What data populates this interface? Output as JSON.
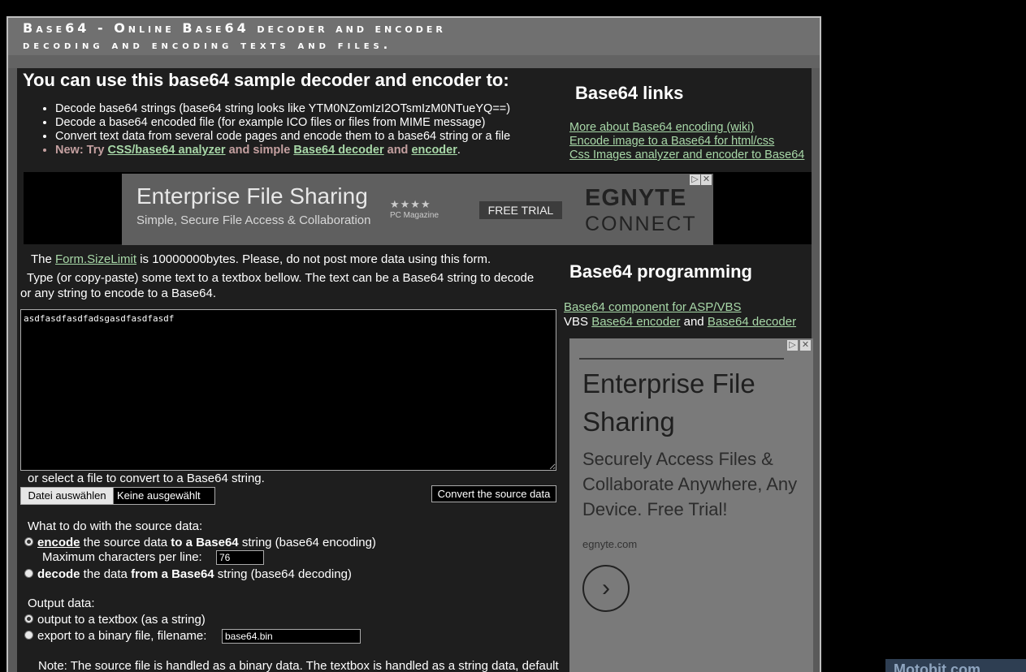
{
  "header": {
    "line1": "Base64 - Online Base64 decoder and encoder",
    "line2": "decoding and encoding texts and files."
  },
  "intro": {
    "title": "You can use this base64 sample decoder and encoder to:",
    "items": [
      "Decode base64 strings (base64 string looks like YTM0NZomIzI2OTsmIzM0NTueYQ==)",
      "Decode a base64 encoded file (for example ICO files or files from MIME message)",
      "Convert text data from several code pages and encode them to a base64 string or a file"
    ],
    "new_prefix": "New: Try ",
    "new_link1": "CSS/base64 analyzer",
    "new_mid1": " and simple ",
    "new_link2": "Base64 decoder",
    "new_mid2": " and ",
    "new_link3": "encoder",
    "new_end": "."
  },
  "links": {
    "title": "Base64 links",
    "items": [
      "More about Base64 encoding (wiki)",
      "Encode image to a Base64 for html/css",
      "Css Images analyzer and encoder to Base64"
    ]
  },
  "ad_banner": {
    "title": "Enterprise File Sharing",
    "subtitle": "Simple, Secure File Access & Collaboration",
    "stars": "★★★★",
    "magazine": "PC Magazine",
    "cta": "FREE TRIAL",
    "logo_line1": "EGNYTE",
    "logo_line2": "CONNECT",
    "choice_icon": "▷",
    "close_icon": "✕"
  },
  "form": {
    "size_prefix": "The ",
    "size_link": "Form.SizeLimit",
    "size_suffix": " is 10000000bytes. Please, do not post more data using this form.",
    "type_text": "Type (or copy-paste) some text to a textbox bellow. The text can be a Base64 string to decode or any string to encode to a Base64.",
    "textarea_value": "asdfasdfasdfadsgasdfasdfasdf",
    "select_file_text": "or select a file to convert to a Base64 string.",
    "file_button": "Datei auswählen",
    "file_none": "Keine ausgewählt",
    "convert_button": "Convert the source data",
    "what_to_do": "What to do with the source data:",
    "encode_b1": "encode",
    "encode_mid": " the source data ",
    "encode_b2": "to a Base64",
    "encode_end": " string (base64 encoding)",
    "max_chars_label": "Maximum characters per line:",
    "max_chars_value": "76",
    "decode_b1": "decode",
    "decode_mid": " the data ",
    "decode_b2": "from a Base64",
    "decode_end": " string (base64 decoding)",
    "output_label": "Output data:",
    "output_textbox": "output to a textbox (as a string)",
    "output_file": "export to a binary file, filename:",
    "filename_value": "base64.bin",
    "note": "Note: The source file is handled as a binary data. The textbox is handled as a string data, default character set for the textbox is 'iso-8859-1'. You can change the charset using form"
  },
  "programming": {
    "title": "Base64 programming",
    "component_link": "Base64 component for ASP/VBS",
    "vbs_prefix": "VBS ",
    "encoder_link": "Base64 encoder",
    "and_text": " and ",
    "decoder_link": "Base64 decoder"
  },
  "ad_side": {
    "title": "Enterprise File Sharing",
    "subtitle": "Securely Access Files & Collaborate Anywhere, Any Device. Free Trial!",
    "domain": "egnyte.com",
    "arrow": "›"
  },
  "watermark": "Motobit.com"
}
